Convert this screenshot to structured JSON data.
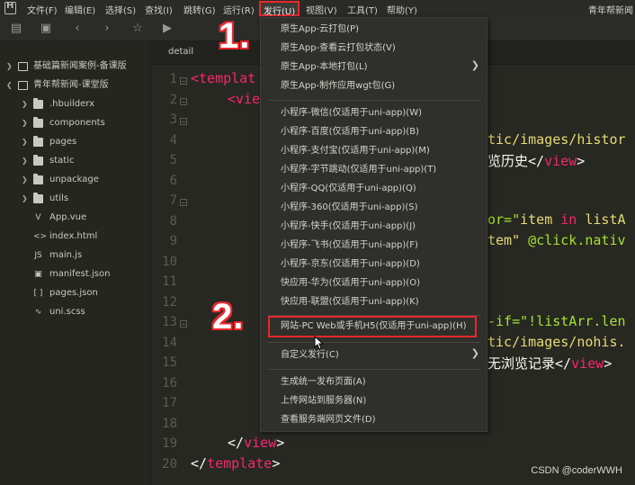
{
  "menubar": {
    "items": [
      "文件(F)",
      "编辑(E)",
      "选择(S)",
      "查找(I)",
      "跳转(G)",
      "运行(R)",
      "发行(U)",
      "视图(V)",
      "工具(T)",
      "帮助(Y)"
    ],
    "window_title": "青年帮新闻"
  },
  "sidebar": {
    "projects": [
      {
        "label": "基础篇新闻案例-备课版"
      },
      {
        "label": "青年帮新闻-课堂版"
      }
    ],
    "folders": [
      ".hbuilderx",
      "components",
      "pages",
      "static",
      "unpackage",
      "utils"
    ],
    "files": [
      "App.vue",
      "index.html",
      "main.js",
      "manifest.json",
      "pages.json",
      "uni.scss"
    ]
  },
  "editor": {
    "tab_label": "detail",
    "line_numbers": [
      "1",
      "2",
      "3",
      "4",
      "5",
      "6",
      "7",
      "8",
      "9",
      "10",
      "11",
      "12",
      "13",
      "14",
      "15",
      "16",
      "17",
      "18",
      "19",
      "20"
    ],
    "code_fragments": {
      "l1": "<templat",
      "l2": "<vie",
      "l4a": "tic/images/histor",
      "l5a": "览历史</",
      "l5b": "view",
      "l5c": ">",
      "l7a": "or=\"",
      "l7b": "item",
      "l7c": " in ",
      "l7d": "listA",
      "l8a": "tem\" ",
      "l8b": "@click.nativ",
      "l13a": "-if=\"!listArr.len",
      "l14a": "tic/images/nohis.",
      "l15a": "无浏览记录</",
      "l15b": "view",
      "l15c": ">",
      "l19a": "</",
      "l19b": "view",
      "l19c": ">",
      "l20a": "</",
      "l20b": "template",
      "l20c": ">"
    }
  },
  "annotations": {
    "step1": "1.",
    "step2": "2."
  },
  "dropdown": {
    "group1": [
      "原生App-云打包(P)",
      "原生App-查看云打包状态(V)",
      "原生App-本地打包(L)",
      "原生App-制作应用wgt包(G)"
    ],
    "group2": [
      "小程序-微信(仅适用于uni-app)(W)",
      "小程序-百度(仅适用于uni-app)(B)",
      "小程序-支付宝(仅适用于uni-app)(M)",
      "小程序-字节跳动(仅适用于uni-app)(T)",
      "小程序-QQ(仅适用于uni-app)(Q)",
      "小程序-360(仅适用于uni-app)(S)",
      "小程序-快手(仅适用于uni-app)(J)",
      "小程序-飞书(仅适用于uni-app)(F)",
      "小程序-京东(仅适用于uni-app)(D)",
      "快应用-华为(仅适用于uni-app)(O)",
      "快应用-联盟(仅适用于uni-app)(K)"
    ],
    "highlighted": "网站-PC Web或手机H5(仅适用于uni-app)(H)",
    "custom": "自定义发行(C)",
    "group4": [
      "生成统一发布页面(A)",
      "上传网站到服务器(N)",
      "查看服务端网页文件(D)"
    ]
  },
  "watermark": "CSDN @coderWWH",
  "colors": {
    "highlight_red": "#e8272d",
    "background": "#272822"
  }
}
